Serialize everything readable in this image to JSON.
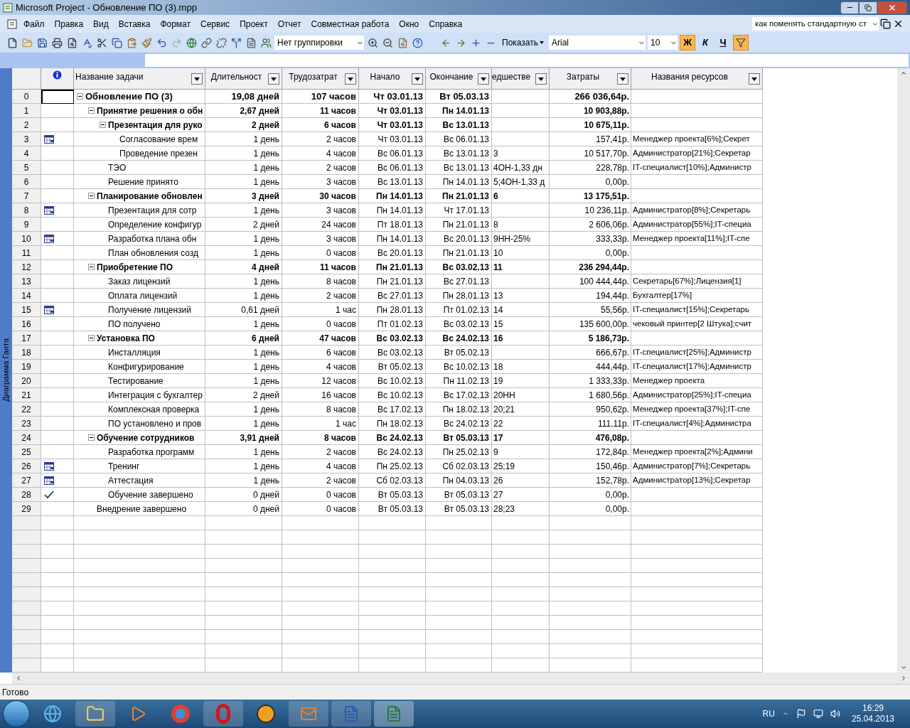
{
  "window": {
    "title": "Microsoft Project - Обновление ПО (3).mpp"
  },
  "menu": [
    "Файл",
    "Правка",
    "Вид",
    "Вставка",
    "Формат",
    "Сервис",
    "Проект",
    "Отчет",
    "Совместная работа",
    "Окно",
    "Справка"
  ],
  "help_search": {
    "value": "как поменять стандартную ст"
  },
  "toolbar": {
    "grouping": "Нет группировки",
    "show": "Показать",
    "font": "Arial",
    "font_size": "10",
    "format_buttons": [
      {
        "label": "Ж",
        "selected": true
      },
      {
        "label": "К",
        "selected": false
      },
      {
        "label": "Ч",
        "selected": false
      }
    ],
    "autofilter_on": true
  },
  "view_bar": {
    "label": "Диаграмма Ганта"
  },
  "table": {
    "columns": [
      "Название задачи",
      "Длительност",
      "Трудозатрат",
      "Начало",
      "Окончание",
      "едшестве",
      "Затраты",
      "Названия ресурсов"
    ],
    "rows": [
      {
        "id": "0",
        "name": "Обновление ПО (3)",
        "duration": "19,08 дней",
        "work": "107 часов",
        "start": "Чт 03.01.13",
        "finish": "Вт 05.03.13",
        "cost": "266 036,64р.",
        "selected": true,
        "expanded": true,
        "children": [
          {
            "id": "1",
            "name": "Принятие решения о обн",
            "duration": "2,67 дней",
            "work": "11 часов",
            "start": "Чт 03.01.13",
            "finish": "Пн 14.01.13",
            "cost": "10 903,88р.",
            "selected": false,
            "expanded": true,
            "children": [
              {
                "id": "2",
                "name": "Презентация для руко",
                "duration": "2 дней",
                "work": "6 часов",
                "start": "Чт 03.01.13",
                "finish": "Вс 13.01.13",
                "cost": "10 675,11р.",
                "selected": false,
                "expanded": true,
                "children": [
                  {
                    "id": "3",
                    "kind": "calendar",
                    "name": "Согласование врем",
                    "duration": "1 день",
                    "work": "2 часов",
                    "start": "Чт 03.01.13",
                    "finish": "Вс 06.01.13",
                    "cost": "157,41р.",
                    "resources": "Менеджер проекта[6%];Секрет",
                    "selected": false
                  },
                  {
                    "id": "4",
                    "name": "Проведение презен",
                    "duration": "1 день",
                    "work": "4 часов",
                    "start": "Вс 06.01.13",
                    "finish": "Вс 13.01.13",
                    "predecessors": "3",
                    "cost": "10 517,70р.",
                    "resources": "Администратор[21%];Секретар",
                    "selected": false
                  }
                ]
              },
              {
                "id": "5",
                "name": "ТЭО",
                "duration": "1 день",
                "work": "2 часов",
                "start": "Вс 06.01.13",
                "finish": "Вс 13.01.13",
                "predecessors": "4ОН-1,33 дн",
                "cost": "228,78р.",
                "resources": "IT-специалист[10%];Администр",
                "selected": false
              },
              {
                "id": "6",
                "name": "Решение принято",
                "duration": "1 день",
                "work": "3 часов",
                "start": "Вс 13.01.13",
                "finish": "Пн 14.01.13",
                "predecessors": "5;4ОН-1,33 д",
                "cost": "0,00р.",
                "selected": false
              }
            ]
          },
          {
            "id": "7",
            "name": "Планирование обновлен",
            "duration": "3 дней",
            "work": "30 часов",
            "start": "Пн 14.01.13",
            "finish": "Пн 21.01.13",
            "predecessors": "6",
            "cost": "13 175,51р.",
            "selected": false,
            "expanded": true,
            "children": [
              {
                "id": "8",
                "kind": "calendar",
                "name": "Презентация для сотр",
                "duration": "1 день",
                "work": "3 часов",
                "start": "Пн 14.01.13",
                "finish": "Чт 17.01.13",
                "cost": "10 236,11р.",
                "resources": "Администратор[8%];Секретарь",
                "selected": false
              },
              {
                "id": "9",
                "name": "Определение конфигур",
                "duration": "2 дней",
                "work": "24 часов",
                "start": "Пт 18.01.13",
                "finish": "Пн 21.01.13",
                "predecessors": "8",
                "cost": "2 606,06р.",
                "resources": "Администратор[55%];IT-специа",
                "selected": false
              },
              {
                "id": "10",
                "kind": "calendar",
                "name": "Разработка плана обн",
                "duration": "1 день",
                "work": "3 часов",
                "start": "Пн 14.01.13",
                "finish": "Вс 20.01.13",
                "predecessors": "9НН-25%",
                "cost": "333,33р.",
                "resources": "Менеджер проекта[11%];IT-спе",
                "selected": false
              },
              {
                "id": "11",
                "name": "План обновления созд",
                "duration": "1 день",
                "work": "0 часов",
                "start": "Вс 20.01.13",
                "finish": "Пн 21.01.13",
                "predecessors": "10",
                "cost": "0,00р.",
                "selected": false
              }
            ]
          },
          {
            "id": "12",
            "name": "Приобретение ПО",
            "duration": "4 дней",
            "work": "11 часов",
            "start": "Пн 21.01.13",
            "finish": "Вс 03.02.13",
            "predecessors": "11",
            "cost": "236 294,44р.",
            "selected": false,
            "expanded": true,
            "children": [
              {
                "id": "13",
                "name": "Заказ лицензий",
                "duration": "1 день",
                "work": "8 часов",
                "start": "Пн 21.01.13",
                "finish": "Вс 27.01.13",
                "cost": "100 444,44р.",
                "resources": "Секретарь[67%];Лицензия[1]",
                "selected": false
              },
              {
                "id": "14",
                "name": "Оплата лицензий",
                "duration": "1 день",
                "work": "2 часов",
                "start": "Вс 27.01.13",
                "finish": "Пн 28.01.13",
                "predecessors": "13",
                "cost": "194,44р.",
                "resources": "Бухгалтер[17%]",
                "selected": false
              },
              {
                "id": "15",
                "kind": "calendar",
                "name": "Получение лицензий",
                "duration": "0,61 дней",
                "work": "1 час",
                "start": "Пн 28.01.13",
                "finish": "Пт 01.02.13",
                "predecessors": "14",
                "cost": "55,56р.",
                "resources": "IT-специалист[15%];Секретарь",
                "selected": false
              },
              {
                "id": "16",
                "name": "ПО получено",
                "duration": "1 день",
                "work": "0 часов",
                "start": "Пт 01.02.13",
                "finish": "Вс 03.02.13",
                "predecessors": "15",
                "cost": "135 600,00р.",
                "resources": "чековый принтер[2 Штука];счит",
                "selected": false
              }
            ]
          },
          {
            "id": "17",
            "name": "Установка ПО",
            "duration": "6 дней",
            "work": "47 часов",
            "start": "Вс 03.02.13",
            "finish": "Вс 24.02.13",
            "predecessors": "16",
            "cost": "5 186,73р.",
            "selected": false,
            "expanded": true,
            "children": [
              {
                "id": "18",
                "name": "Инсталляция",
                "duration": "1 день",
                "work": "6 часов",
                "start": "Вс 03.02.13",
                "finish": "Вт 05.02.13",
                "cost": "666,67р.",
                "resources": "IT-специалист[25%];Администр",
                "selected": false
              },
              {
                "id": "19",
                "name": "Конфигурирование",
                "duration": "1 день",
                "work": "4 часов",
                "start": "Вт 05.02.13",
                "finish": "Вс 10.02.13",
                "predecessors": "18",
                "cost": "444,44р.",
                "resources": "IT-специалист[17%];Администр",
                "selected": false
              },
              {
                "id": "20",
                "name": "Тестирование",
                "duration": "1 день",
                "work": "12 часов",
                "start": "Вс 10.02.13",
                "finish": "Пн 11.02.13",
                "predecessors": "19",
                "cost": "1 333,33р.",
                "resources": "Менеджер проекта",
                "selected": false
              },
              {
                "id": "21",
                "name": "Интеграция с бухгалтер",
                "duration": "2 дней",
                "work": "16 часов",
                "start": "Вс 10.02.13",
                "finish": "Вс 17.02.13",
                "predecessors": "20НН",
                "cost": "1 680,56р.",
                "resources": "Администратор[25%];IT-специа",
                "selected": false
              },
              {
                "id": "22",
                "name": "Комплексная проверка",
                "duration": "1 день",
                "work": "8 часов",
                "start": "Вс 17.02.13",
                "finish": "Пн 18.02.13",
                "predecessors": "20;21",
                "cost": "950,62р.",
                "resources": "Менеджер проекта[37%];IT-спе",
                "selected": false
              },
              {
                "id": "23",
                "name": "ПО установлено и пров",
                "duration": "1 день",
                "work": "1 час",
                "start": "Пн 18.02.13",
                "finish": "Вс 24.02.13",
                "predecessors": "22",
                "cost": "111,11р.",
                "resources": "IT-специалист[4%];Администра",
                "selected": false
              }
            ]
          },
          {
            "id": "24",
            "name": "Обучение сотрудников",
            "duration": "3,91 дней",
            "work": "8 часов",
            "start": "Вс 24.02.13",
            "finish": "Вт 05.03.13",
            "predecessors": "17",
            "cost": "476,08р.",
            "selected": false,
            "expanded": true,
            "children": [
              {
                "id": "25",
                "name": "Разработка программ",
                "duration": "1 день",
                "work": "2 часов",
                "start": "Вс 24.02.13",
                "finish": "Пн 25.02.13",
                "predecessors": "9",
                "cost": "172,84р.",
                "resources": "Менеджер проекта[2%];Админи",
                "selected": false
              },
              {
                "id": "26",
                "kind": "calendar",
                "name": "Тренинг",
                "duration": "1 день",
                "work": "4 часов",
                "start": "Пн 25.02.13",
                "finish": "Сб 02.03.13",
                "predecessors": "25;19",
                "cost": "150,46р.",
                "resources": "Администратор[7%];Секретарь",
                "selected": false
              },
              {
                "id": "27",
                "kind": "calendar",
                "name": "Аттестация",
                "duration": "1 день",
                "work": "2 часов",
                "start": "Сб 02.03.13",
                "finish": "Пн 04.03.13",
                "predecessors": "26",
                "cost": "152,78р.",
                "resources": "Администратор[13%];Секретар",
                "selected": false
              },
              {
                "id": "28",
                "kind": "check",
                "name": "Обучение завершено",
                "duration": "0 дней",
                "work": "0 часов",
                "start": "Вт 05.03.13",
                "finish": "Вт 05.03.13",
                "predecessors": "27",
                "cost": "0,00р.",
                "selected": false
              }
            ]
          },
          {
            "id": "29",
            "name": "Внедрение завершено",
            "duration": "0 дней",
            "work": "0 часов",
            "start": "Вт 05.03.13",
            "finish": "Вт 05.03.13",
            "predecessors": "28;23",
            "cost": "0,00р.",
            "selected": false
          }
        ]
      }
    ]
  },
  "status_bar": {
    "text": "Готово"
  },
  "taskbar": {
    "language": "RU",
    "time": "16:29",
    "date": "25.04.2013"
  }
}
